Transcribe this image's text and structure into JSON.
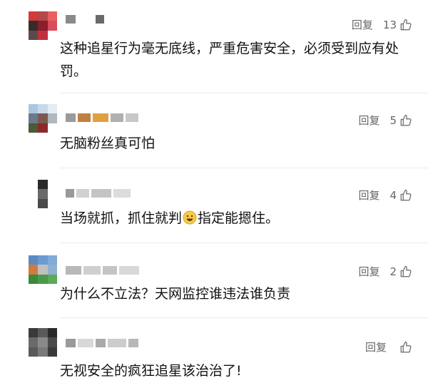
{
  "comments": [
    {
      "text": "这种追星行为毫无底线，严重危害安全，必须受到应有处罚。",
      "reply_label": "回复",
      "likes": "13"
    },
    {
      "text": "无脑粉丝真可怕",
      "reply_label": "回复",
      "likes": "5"
    },
    {
      "text_before": "当场就抓，抓住就判",
      "text_after": "指定能摁住。",
      "emoji": "grinning-face",
      "reply_label": "回复",
      "likes": "4"
    },
    {
      "text": "为什么不立法？天网监控谁违法谁负责",
      "reply_label": "回复",
      "likes": "2"
    },
    {
      "text": "无视安全的疯狂追星该治治了!",
      "reply_label": "回复",
      "likes": ""
    }
  ],
  "icons": {
    "like": "thumbs-up-icon"
  },
  "colors": {
    "meta_text": "#666666",
    "body_text": "#111111"
  }
}
